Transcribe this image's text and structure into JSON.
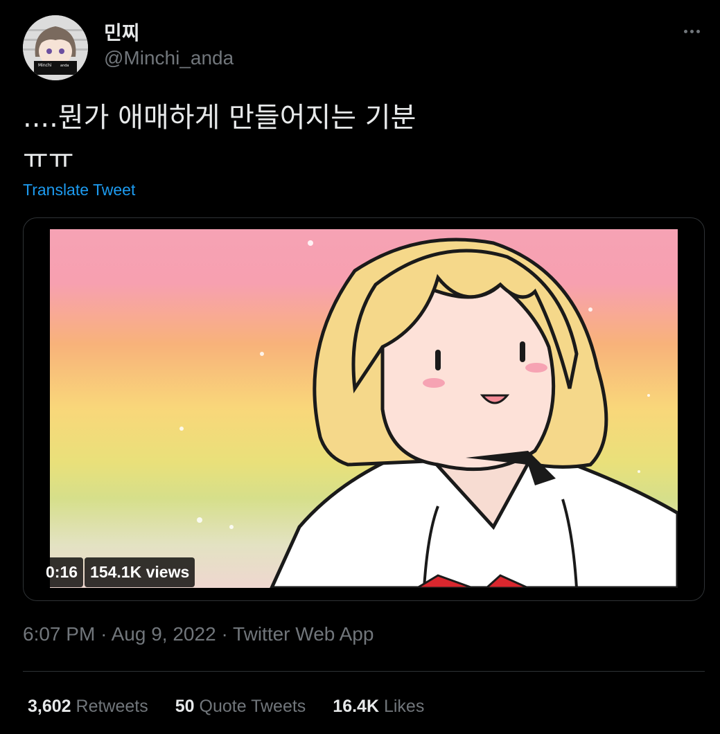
{
  "author": {
    "display_name": "민찌",
    "handle": "@Minchi_anda",
    "avatar_badge_line1": "Minchi",
    "avatar_badge_line2": "anda"
  },
  "tweet": {
    "text": "....뭔가 애매하게 만들어지는 기분\nㅠㅠ",
    "translate_label": "Translate Tweet"
  },
  "media": {
    "duration": "0:16",
    "views": "154.1K views"
  },
  "meta": {
    "time": "6:07 PM",
    "separator": "·",
    "date": "Aug 9, 2022",
    "source": "Twitter Web App"
  },
  "stats": {
    "retweets_count": "3,602",
    "retweets_label": "Retweets",
    "quotes_count": "50",
    "quotes_label": "Quote Tweets",
    "likes_count": "16.4K",
    "likes_label": "Likes"
  },
  "colors": {
    "background": "#000000",
    "text_primary": "#e7e9ea",
    "text_secondary": "#71767b",
    "link": "#1d9bf0",
    "border": "#2f3336"
  },
  "icons": {
    "more": "more-dots-icon"
  }
}
